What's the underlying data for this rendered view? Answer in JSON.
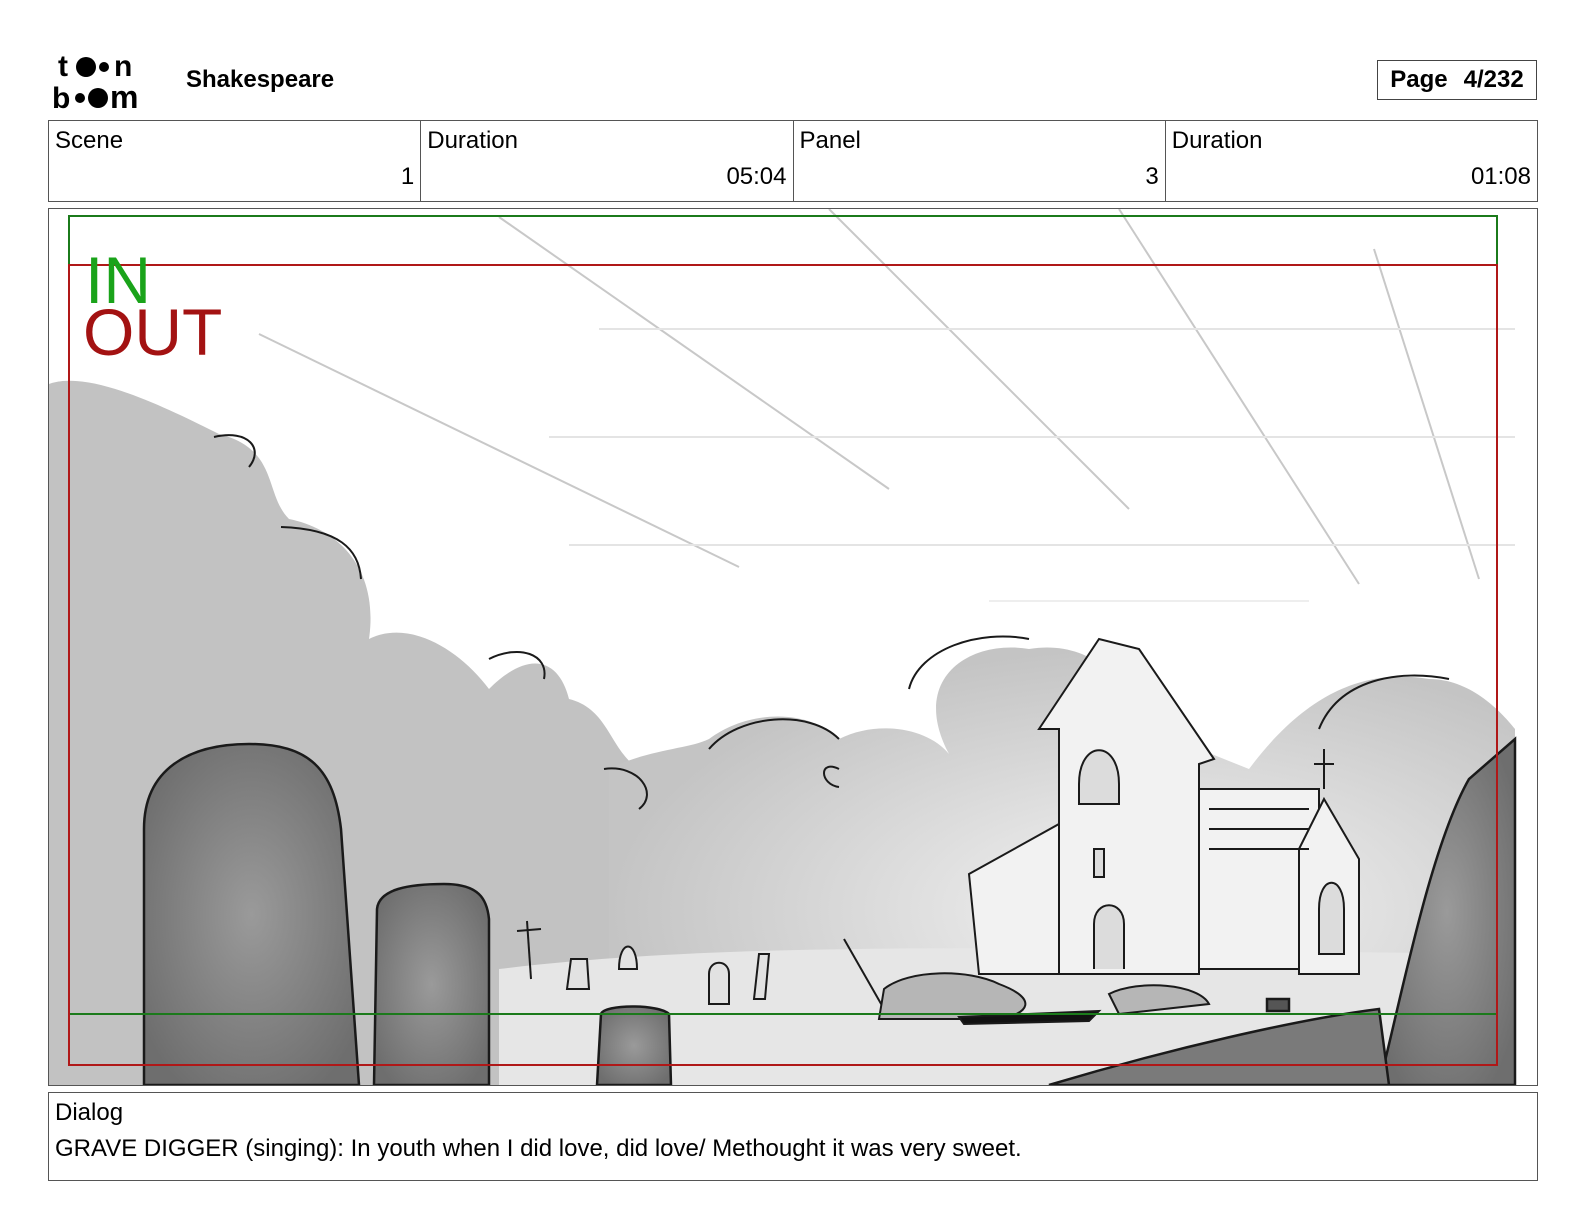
{
  "header": {
    "logo_text": "toon boom",
    "project_name": "Shakespeare",
    "page_label": "Page",
    "page_value": "4/232"
  },
  "info": {
    "scene_label": "Scene",
    "scene_value": "1",
    "scene_duration_label": "Duration",
    "scene_duration_value": "05:04",
    "panel_label": "Panel",
    "panel_value": "3",
    "panel_duration_label": "Duration",
    "panel_duration_value": "01:08"
  },
  "frame_markers": {
    "in_label": "IN",
    "out_label": "OUT",
    "in_color": "#1aa31a",
    "out_color": "#a31212"
  },
  "dialog": {
    "label": "Dialog",
    "text": "GRAVE DIGGER (singing): In youth when I did love, did love/ Methought it was very sweet."
  }
}
